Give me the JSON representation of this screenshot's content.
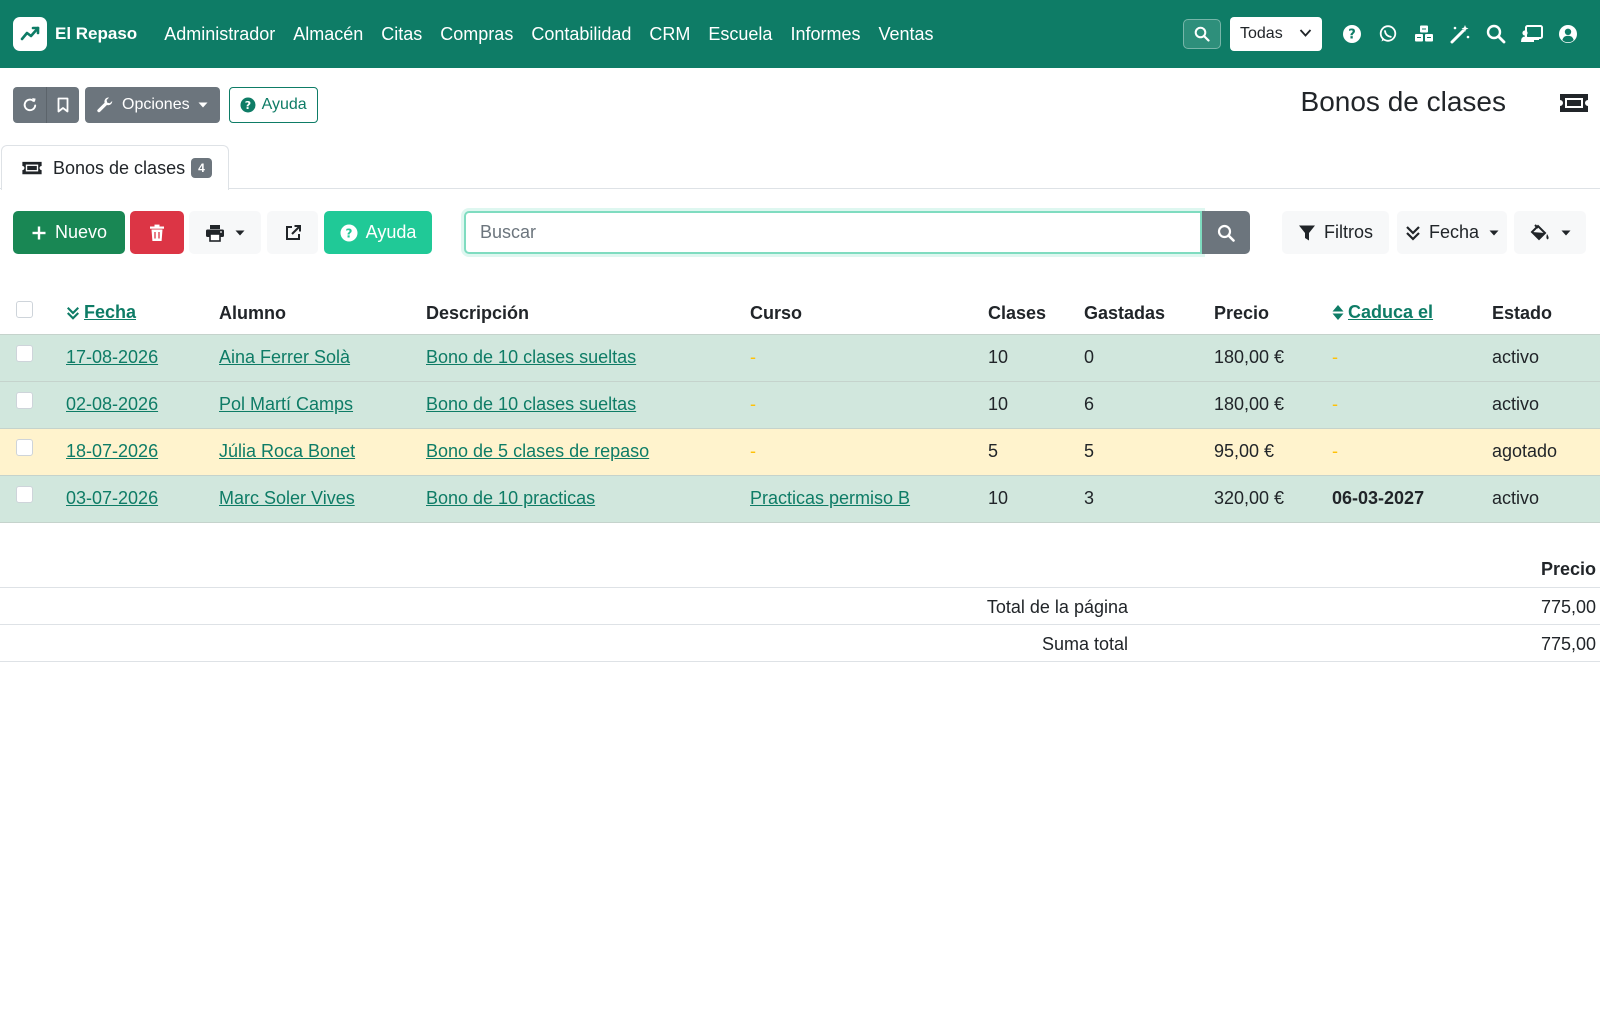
{
  "navbar": {
    "brand": "El Repaso",
    "menu": [
      "Administrador",
      "Almacén",
      "Citas",
      "Compras",
      "Contabilidad",
      "CRM",
      "Escuela",
      "Informes",
      "Ventas"
    ],
    "company_select": "Todas",
    "icons": [
      "help-icon",
      "whatsapp-icon",
      "cubes-icon",
      "magic-wand-icon",
      "search-icon",
      "chalkboard-icon",
      "user-icon"
    ]
  },
  "toolbar": {
    "options_label": "Opciones",
    "help_label": "Ayuda"
  },
  "page": {
    "title": "Bonos de clases"
  },
  "tab": {
    "label": "Bonos de clases",
    "count": "4"
  },
  "actions": {
    "new_label": "Nuevo",
    "help_label": "Ayuda",
    "search_placeholder": "Buscar",
    "filters_label": "Filtros",
    "order_label": "Fecha"
  },
  "table": {
    "columns": [
      "Fecha",
      "Alumno",
      "Descripción",
      "Curso",
      "Clases",
      "Gastadas",
      "Precio",
      "Caduca el",
      "Estado"
    ],
    "rows": [
      {
        "fecha": "17-08-2026",
        "alumno": "Aina Ferrer Solà",
        "descripcion": "Bono de 10 clases sueltas",
        "curso": "-",
        "clases": "10",
        "gastadas": "0",
        "precio": "180,00 €",
        "caduca": "-",
        "estado": "activo",
        "status": "ok"
      },
      {
        "fecha": "02-08-2026",
        "alumno": "Pol Martí Camps",
        "descripcion": "Bono de 10 clases sueltas",
        "curso": "-",
        "clases": "10",
        "gastadas": "6",
        "precio": "180,00 €",
        "caduca": "-",
        "estado": "activo",
        "status": "ok"
      },
      {
        "fecha": "18-07-2026",
        "alumno": "Júlia Roca Bonet",
        "descripcion": "Bono de 5 clases de repaso",
        "curso": "-",
        "clases": "5",
        "gastadas": "5",
        "precio": "95,00 €",
        "caduca": "-",
        "estado": "agotado",
        "status": "warn"
      },
      {
        "fecha": "03-07-2026",
        "alumno": "Marc Soler Vives",
        "descripcion": "Bono de 10 practicas",
        "curso": "Practicas permiso B",
        "clases": "10",
        "gastadas": "3",
        "precio": "320,00 €",
        "caduca": "06-03-2027",
        "estado": "activo",
        "status": "ok"
      }
    ]
  },
  "totals": {
    "column": "Precio",
    "page_total_label": "Total de la página",
    "page_total": "775,00",
    "grand_total_label": "Suma total",
    "grand_total": "775,00"
  },
  "colors": {
    "primary": "#0e7c66",
    "success": "#198754",
    "danger": "#dc3545",
    "teal": "#20c997",
    "row_ok": "#d1e7dd",
    "row_warn": "#fff3cd"
  }
}
